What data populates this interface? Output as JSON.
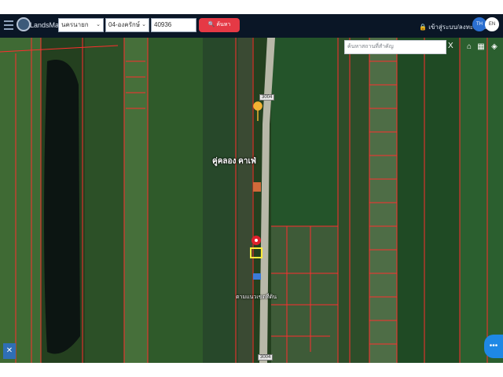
{
  "header": {
    "brand": "LandsMaps",
    "province": "นครนายก",
    "district": "04-องครักษ์",
    "parcel_number": "40936",
    "search_label": "ค้นหา",
    "login_label": "เข้าสู่ระบบ/ลงทะเบียน",
    "lang_th": "TH",
    "lang_en": "EN"
  },
  "map": {
    "search_placeholder": "ค้นหาสถานที่สำคัญ",
    "close": "X",
    "place_label": "คู่คลอง คาเฟ่",
    "road_labels": [
      "3004",
      "3004"
    ],
    "parcel_label": "ตามแนวเขตที่ดิน",
    "colors": {
      "parcel_border": "#ff2e2e",
      "highlight": "#ffeb3b",
      "marker": "#e0202c"
    }
  },
  "icons": {
    "menu": "hamburger-icon",
    "lock": "lock-icon",
    "home": "home-icon",
    "keyboard": "keyboard-icon",
    "layers": "layers-icon",
    "more": "more-dots-icon",
    "tool": "tool-icon"
  }
}
